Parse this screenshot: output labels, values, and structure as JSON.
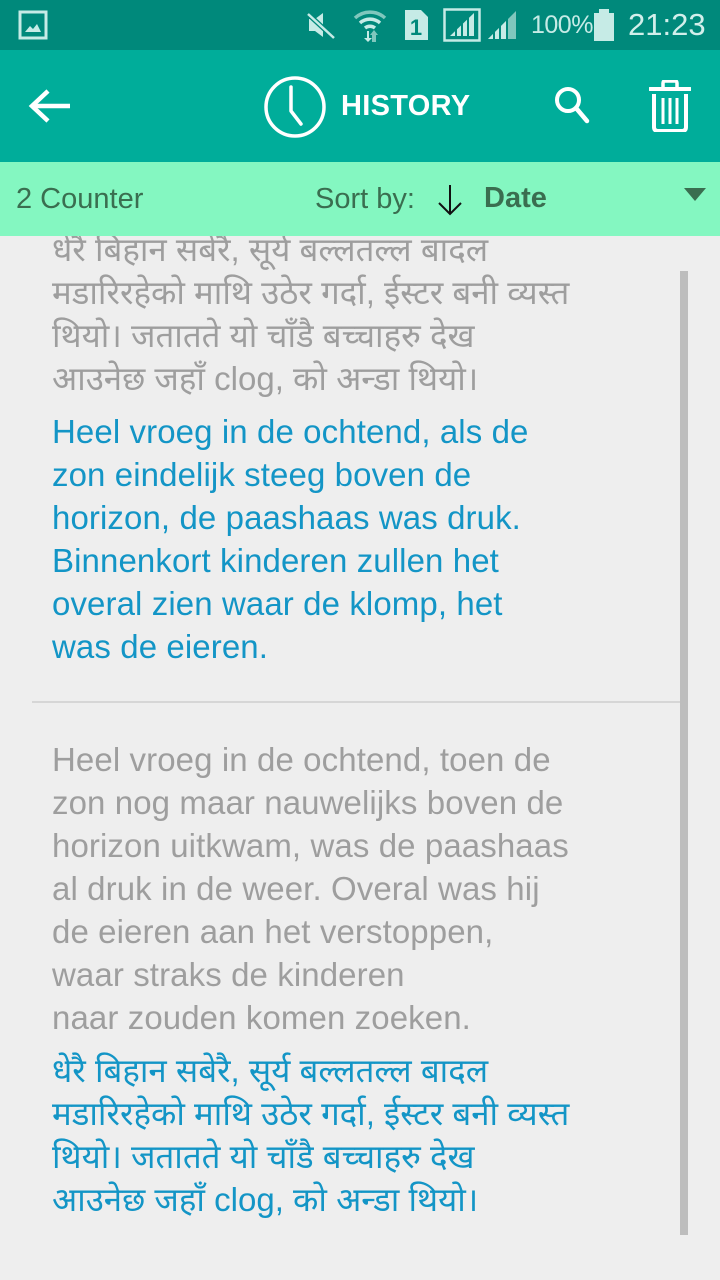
{
  "status_bar": {
    "icons": [
      "gallery-notification-icon",
      "mute-icon",
      "wifi-data-icon",
      "sim-1-icon",
      "signal-sim1-icon",
      "signal-sim2-icon",
      "battery-icon"
    ],
    "battery": "100%",
    "time": "21:23"
  },
  "app_bar": {
    "back_icon": "arrow-left",
    "title_icon": "clock",
    "title": "HISTORY",
    "search_icon": "magnifier",
    "delete_icon": "trash-can",
    "colors": {
      "background": "#00ad9a",
      "status_bar": "#00897b",
      "foreground": "#ffffff"
    }
  },
  "sort_bar": {
    "counter": "2 Counter",
    "sort_label": "Sort by:",
    "sort_direction_icon": "arrow-down",
    "sort_value": "Date",
    "dropdown_icon": "triangle-down",
    "colors": {
      "background": "#84f7c1",
      "text": "#3a6e50"
    }
  },
  "history": {
    "colors": {
      "source_text": "#9e9e9e",
      "translated_text": "#1395c6"
    },
    "entries": [
      {
        "source_lines": [
          "धेरै बिहान सबेरै, सूर्य बल्लतल्ल बादल",
          "मडारिरहेको माथि उठेर गर्दा, ईस्टर बनी व्यस्त",
          "थियो। जतातते यो चाँडै बच्चाहरु देख",
          "आउनेछ जहाँ clog, को अन्डा थियो।"
        ],
        "translation_lines": [
          "Heel vroeg in de ochtend, als de",
          "zon eindelijk steeg boven de",
          "horizon, de paashaas was druk.",
          "Binnenkort kinderen zullen het",
          "overal zien waar de klomp, het",
          "was de eieren."
        ]
      },
      {
        "source_lines": [
          "Heel vroeg in de ochtend, toen de",
          "zon nog maar nauwelijks boven de",
          "horizon uitkwam, was de paashaas",
          "al druk in de weer. Overal was hij",
          "de eieren aan het verstoppen,",
          "waar straks de kinderen",
          "naar zouden komen zoeken."
        ],
        "translation_lines": [
          "धेरै बिहान सबेरै, सूर्य बल्लतल्ल बादल",
          "मडारिरहेको माथि उठेर गर्दा, ईस्टर बनी व्यस्त",
          "थियो। जतातते यो चाँडै बच्चाहरु देख",
          "आउनेछ जहाँ clog, को अन्डा थियो।"
        ]
      }
    ]
  }
}
